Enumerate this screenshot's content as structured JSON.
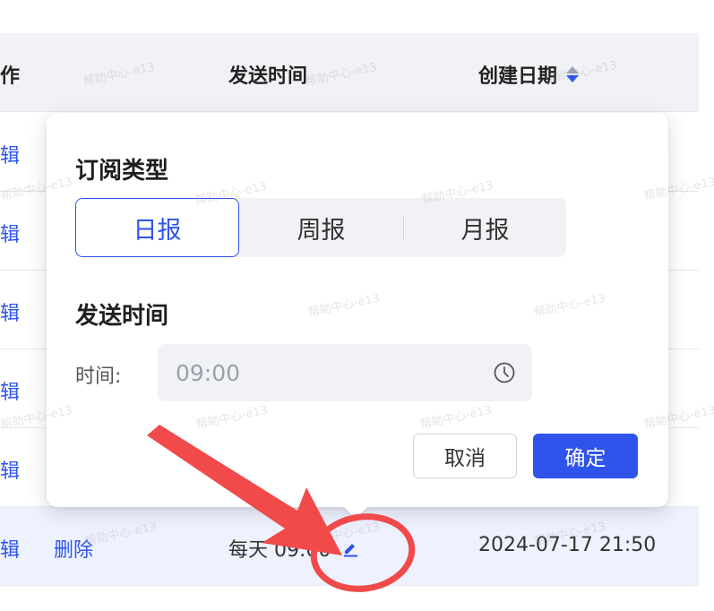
{
  "table": {
    "headers": {
      "operation": "作",
      "send_time": "发送时间",
      "created_date": "创建日期"
    },
    "edit_label": "辑",
    "delete_label": "删除",
    "rows": [
      {
        "send_time": "每天 09:00",
        "created": "2024-07-17 21:50"
      }
    ]
  },
  "popover": {
    "subscription_type_title": "订阅类型",
    "tabs": [
      "日报",
      "周报",
      "月报"
    ],
    "active_tab": "日报",
    "send_time_title": "发送时间",
    "time_label": "时间:",
    "time_value": "09:00",
    "cancel_label": "取消",
    "confirm_label": "确定"
  },
  "watermark": "帮助中心-e13",
  "colors": {
    "primary": "#2f54eb",
    "annotation": "#f04a4a",
    "header_bg": "#f1f2f5",
    "row_highlight": "#eef2fe"
  },
  "icons": {
    "sort": "sort-icon",
    "edit": "pencil-icon",
    "time": "clock-icon"
  }
}
